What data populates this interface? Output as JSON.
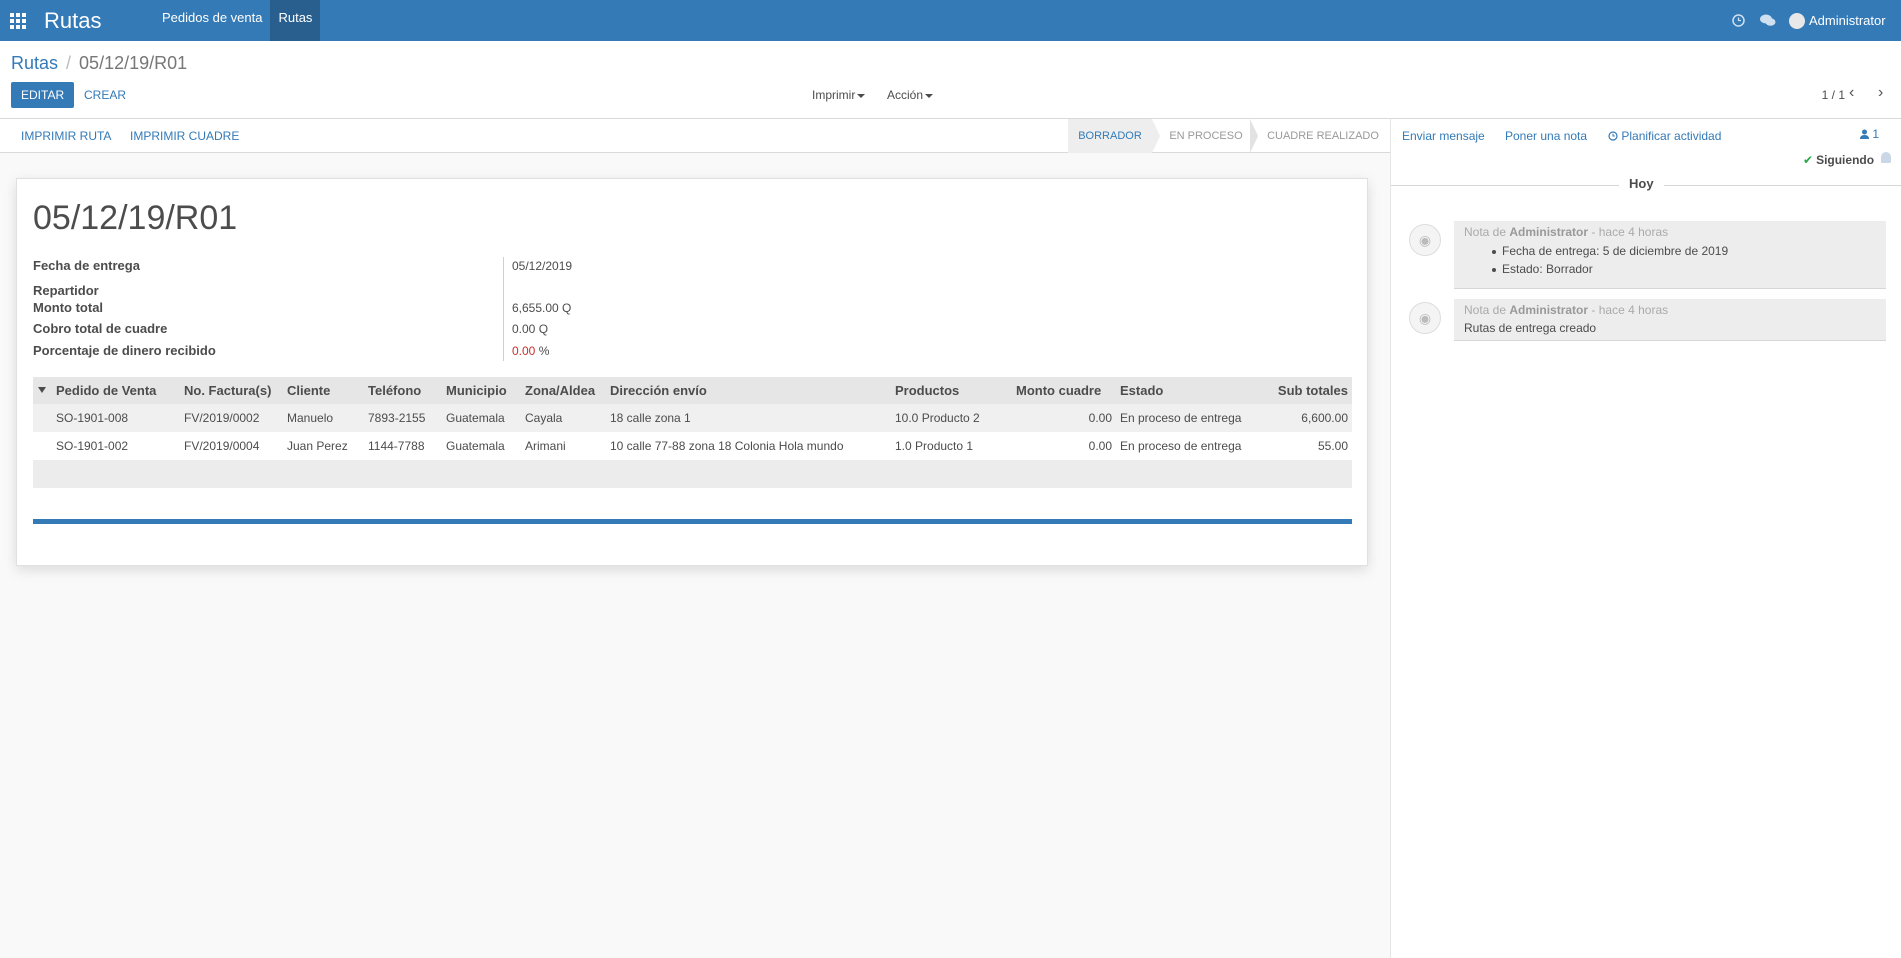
{
  "app": {
    "title": "Rutas",
    "menu": [
      "Pedidos de venta",
      "Rutas"
    ],
    "user": "Administrator"
  },
  "breadcrumb": {
    "parent": "Rutas",
    "separator": "/",
    "current": "05/12/19/R01"
  },
  "control_panel": {
    "edit": "EDITAR",
    "create": "CREAR",
    "print": "Imprimir",
    "action": "Acción",
    "pager": "1 / 1"
  },
  "statusbar": {
    "buttons": [
      "IMPRIMIR RUTA",
      "IMPRIMIR CUADRE"
    ],
    "stages": [
      "BORRADOR",
      "EN PROCESO",
      "CUADRE REALIZADO"
    ],
    "active_stage": "BORRADOR"
  },
  "form": {
    "title": "05/12/19/R01",
    "fields": [
      {
        "label": "Fecha de entrega",
        "value": "05/12/2019"
      },
      {
        "label": "Repartidor",
        "value": ""
      },
      {
        "label": "Monto total",
        "value": "6,655.00 Q"
      },
      {
        "label": "Cobro total de cuadre",
        "value": "0.00 Q"
      },
      {
        "label": "Porcentaje de dinero recibido",
        "value": "0.00",
        "unit": "%"
      }
    ]
  },
  "table": {
    "headers": [
      "Pedido de Venta",
      "No. Factura(s)",
      "Cliente",
      "Teléfono",
      "Municipio",
      "Zona/Aldea",
      "Dirección envío",
      "Productos",
      "Monto cuadre",
      "Estado",
      "Sub totales"
    ],
    "rows": [
      [
        "SO-1901-008",
        "FV/2019/0002",
        "Manuelo",
        "7893-2155",
        "Guatemala",
        "Cayala",
        "18 calle zona 1",
        "10.0 Producto 2",
        "0.00",
        "En proceso de entrega",
        "6,600.00"
      ],
      [
        "SO-1901-002",
        "FV/2019/0004",
        "Juan Perez",
        "1144-7788",
        "Guatemala",
        "Arimani",
        "10 calle 77-88 zona 18 Colonia Hola mundo",
        "1.0 Producto 1",
        "0.00",
        "En proceso de entrega",
        "55.00"
      ]
    ]
  },
  "chatter": {
    "send_message": "Enviar mensaje",
    "log_note": "Poner una nota",
    "schedule_activity": "Planificar actividad",
    "followers_count": "1",
    "following": "Siguiendo",
    "day": "Hoy",
    "messages": [
      {
        "prefix": "Nota de",
        "author": "Administrator",
        "time": "- hace 4 horas",
        "items": [
          "Fecha de entrega: 5 de diciembre de 2019",
          "Estado: Borrador"
        ]
      },
      {
        "prefix": "Nota de",
        "author": "Administrator",
        "time": "- hace 4 horas",
        "body": "Rutas de entrega creado"
      }
    ]
  },
  "colors": {
    "primary": "#337ab7",
    "navbar": "#337ab7",
    "danger": "#c9302c",
    "success": "#28a745"
  }
}
